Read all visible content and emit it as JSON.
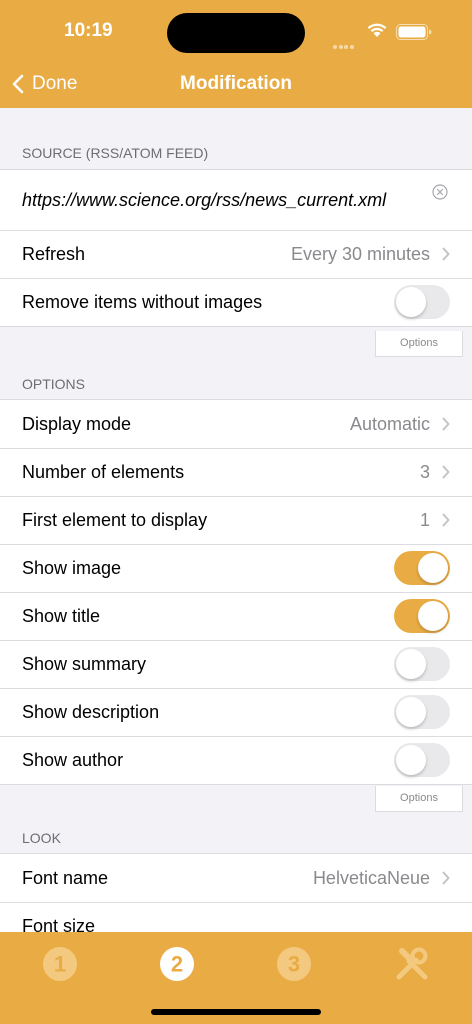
{
  "status_bar": {
    "time": "10:19"
  },
  "nav": {
    "back_label": "Done",
    "title": "Modification"
  },
  "source": {
    "header": "SOURCE (RSS/ATOM FEED)",
    "url": "https://www.science.org/rss/news_current.xml",
    "refresh": {
      "label": "Refresh",
      "value": "Every 30 minutes"
    },
    "remove_no_images": {
      "label": "Remove items without images",
      "on": false
    },
    "options_label": "Options"
  },
  "options": {
    "header": "OPTIONS",
    "display_mode": {
      "label": "Display mode",
      "value": "Automatic"
    },
    "num_elements": {
      "label": "Number of elements",
      "value": "3"
    },
    "first_element": {
      "label": "First element to display",
      "value": "1"
    },
    "show_image": {
      "label": "Show image",
      "on": true
    },
    "show_title": {
      "label": "Show title",
      "on": true
    },
    "show_summary": {
      "label": "Show summary",
      "on": false
    },
    "show_description": {
      "label": "Show description",
      "on": false
    },
    "show_author": {
      "label": "Show author",
      "on": false
    },
    "options_label": "Options"
  },
  "look": {
    "header": "LOOK",
    "font_name": {
      "label": "Font name",
      "value": "HelveticaNeue"
    },
    "font_size": {
      "label": "Font size"
    }
  },
  "tabbar": {
    "tabs": [
      {
        "name": "tab-1",
        "number": "1",
        "selected": false
      },
      {
        "name": "tab-2",
        "number": "2",
        "selected": true
      },
      {
        "name": "tab-3",
        "number": "3",
        "selected": false
      },
      {
        "name": "tab-tools",
        "icon": "tools-icon",
        "selected": false
      }
    ]
  },
  "colors": {
    "accent": "#E9AC44",
    "background": "#F2F2F7",
    "tab_inactive": "#F3C97F"
  }
}
